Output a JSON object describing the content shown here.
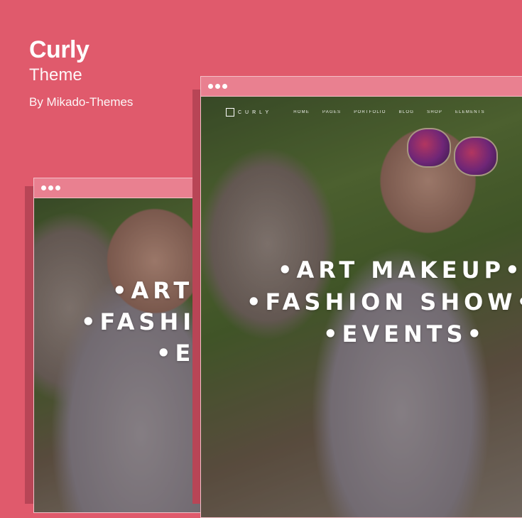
{
  "header": {
    "title": "Curly",
    "subtitle": "Theme",
    "author": "By Mikado-Themes"
  },
  "preview": {
    "nav": {
      "logo": "CURLY",
      "items": [
        "HOME",
        "PAGES",
        "PORTFOLIO",
        "BLOG",
        "SHOP",
        "ELEMENTS"
      ]
    },
    "hero_lines": [
      "•ART MAKEUP•",
      "•FASHION SHOW•",
      "•EVENTS•"
    ],
    "back_hero_lines": [
      "•ART",
      "•FASHIO",
      "•EV"
    ]
  },
  "colors": {
    "background": "#e05a6c",
    "window_bar": "#e98090",
    "text": "#ffffff"
  },
  "icons": [
    "window-dots-icon",
    "logo-box-icon"
  ]
}
